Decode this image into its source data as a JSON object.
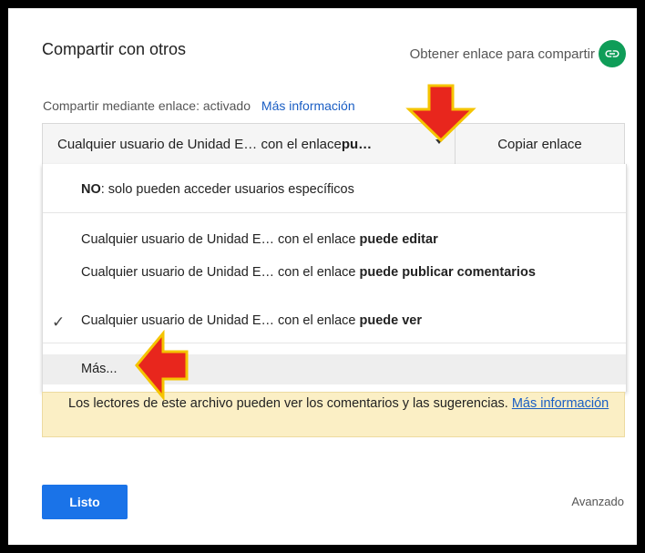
{
  "dialog": {
    "title": "Compartir con otros",
    "get_link_label": "Obtener enlace para compartir",
    "link_status": "Compartir mediante enlace: activado",
    "more_info": "Más información"
  },
  "share_select": {
    "prefix": "Cualquier usuario de Unidad E…  con el enlace ",
    "bold": "pu…"
  },
  "copy_link_label": "Copiar enlace",
  "menu": {
    "items": [
      {
        "bold_prefix": "NO",
        "text": ": solo pueden acceder usuarios específicos"
      },
      {
        "text": "Cualquier usuario de Unidad E…  con el enlace ",
        "bold": "puede editar"
      },
      {
        "text": "Cualquier usuario de Unidad E…  con el enlace ",
        "bold": "puede publicar comentarios"
      },
      {
        "text": "Cualquier usuario de Unidad E…  con el enlace ",
        "bold": "puede ver",
        "checked": true
      },
      {
        "text": "Más..."
      }
    ]
  },
  "info": {
    "text": "Los lectores de este archivo pueden ver los comentarios y las sugerencias.",
    "link": "Más información"
  },
  "footer": {
    "done_label": "Listo",
    "advanced_label": "Avanzado"
  },
  "colors": {
    "accent": "#1a73e8",
    "link_green": "#0f9d58",
    "annotation_arrow": "#e8261d"
  }
}
